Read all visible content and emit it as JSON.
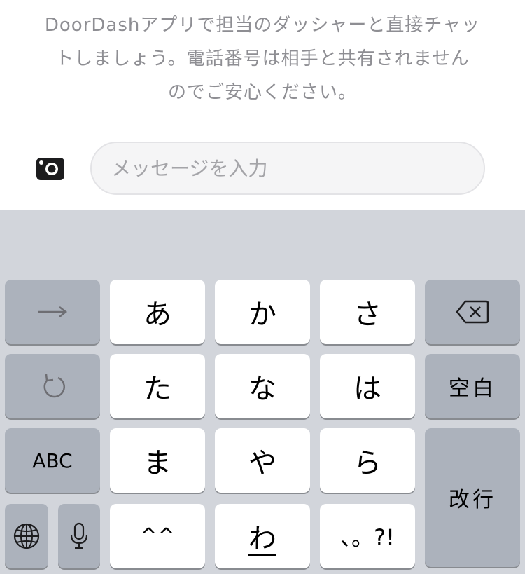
{
  "chat": {
    "info_line1": "DoorDashアプリで担当のダッシャーと直接チャッ",
    "info_line2": "トしましょう。電話番号は相手と共有されません",
    "info_line3": "のでご安心ください。",
    "input_placeholder": "メッセージを入力",
    "camera_icon": "camera-icon"
  },
  "keyboard": {
    "arrow_icon": "arrow-right-icon",
    "undo_icon": "undo-icon",
    "row1": [
      "あ",
      "か",
      "さ"
    ],
    "row2": [
      "た",
      "な",
      "は"
    ],
    "row3": [
      "ま",
      "や",
      "ら"
    ],
    "row4": [
      "^^",
      "わ",
      "、。?!"
    ],
    "backspace_icon": "backspace-icon",
    "space_label": "空白",
    "abc_label": "ABC",
    "return_label": "改行",
    "globe_icon": "globe-icon",
    "mic_icon": "microphone-icon"
  },
  "colors": {
    "keyboard_bg": "#d2d5db",
    "key_white": "#ffffff",
    "key_gray": "#acb2bc",
    "info_text": "#8e8e93"
  }
}
